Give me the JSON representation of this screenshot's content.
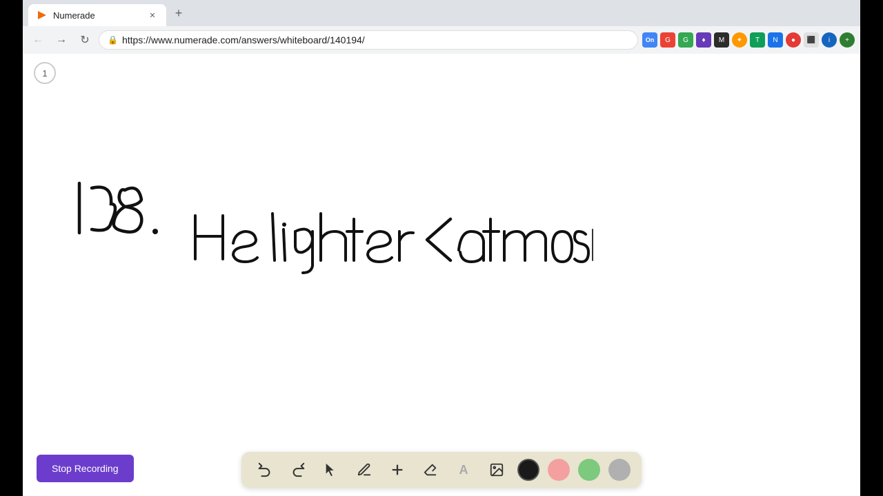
{
  "browser": {
    "tab": {
      "title": "Numerade",
      "favicon": "N",
      "url": "https://www.numerade.com/answers/whiteboard/140194/"
    },
    "new_tab_label": "+"
  },
  "nav": {
    "back_label": "←",
    "forward_label": "→",
    "refresh_label": "↻",
    "address": "https://www.numerade.com/answers/whiteboard/140194/"
  },
  "page_indicator": {
    "number": "1"
  },
  "toolbar": {
    "undo_label": "↩",
    "redo_label": "↪",
    "colors": [
      {
        "name": "black",
        "hex": "#1a1a1a"
      },
      {
        "name": "pink",
        "hex": "#f4a0a0"
      },
      {
        "name": "green",
        "hex": "#7dc97d"
      },
      {
        "name": "gray",
        "hex": "#b0b0b0"
      }
    ]
  },
  "stop_recording": {
    "label": "Stop Recording"
  }
}
